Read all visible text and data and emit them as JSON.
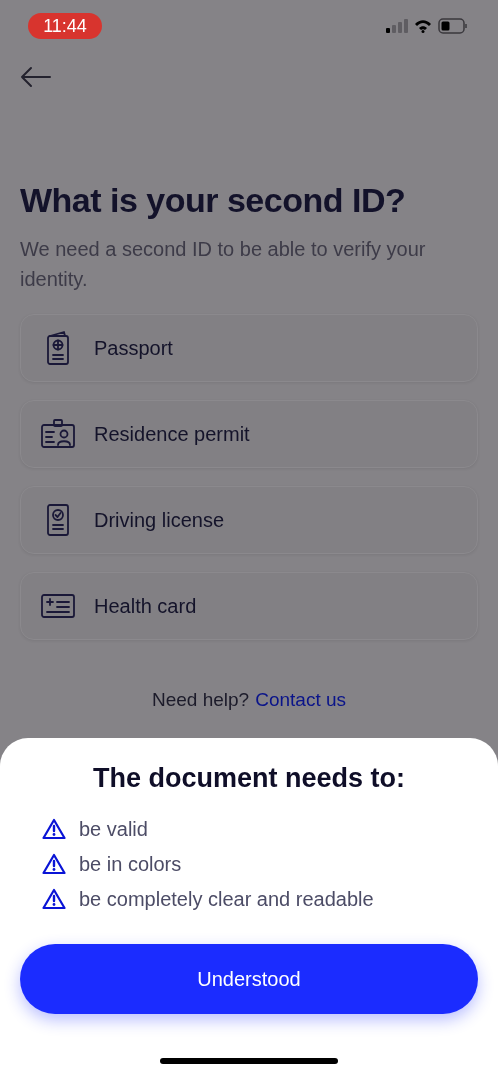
{
  "status_bar": {
    "time": "11:44"
  },
  "title": "What is your second ID?",
  "subtitle": "We need a second ID to be able to verify your identity.",
  "id_options": [
    {
      "kind": "passport",
      "label": "Passport"
    },
    {
      "kind": "residence",
      "label": "Residence permit"
    },
    {
      "kind": "license",
      "label": "Driving license"
    },
    {
      "kind": "health",
      "label": "Health card"
    }
  ],
  "help": {
    "text": "Need help?",
    "link": "Contact us"
  },
  "sheet": {
    "title": "The document needs to:",
    "requirements": [
      "be valid",
      "be in colors",
      "be completely clear and readable"
    ],
    "button": "Understood"
  }
}
